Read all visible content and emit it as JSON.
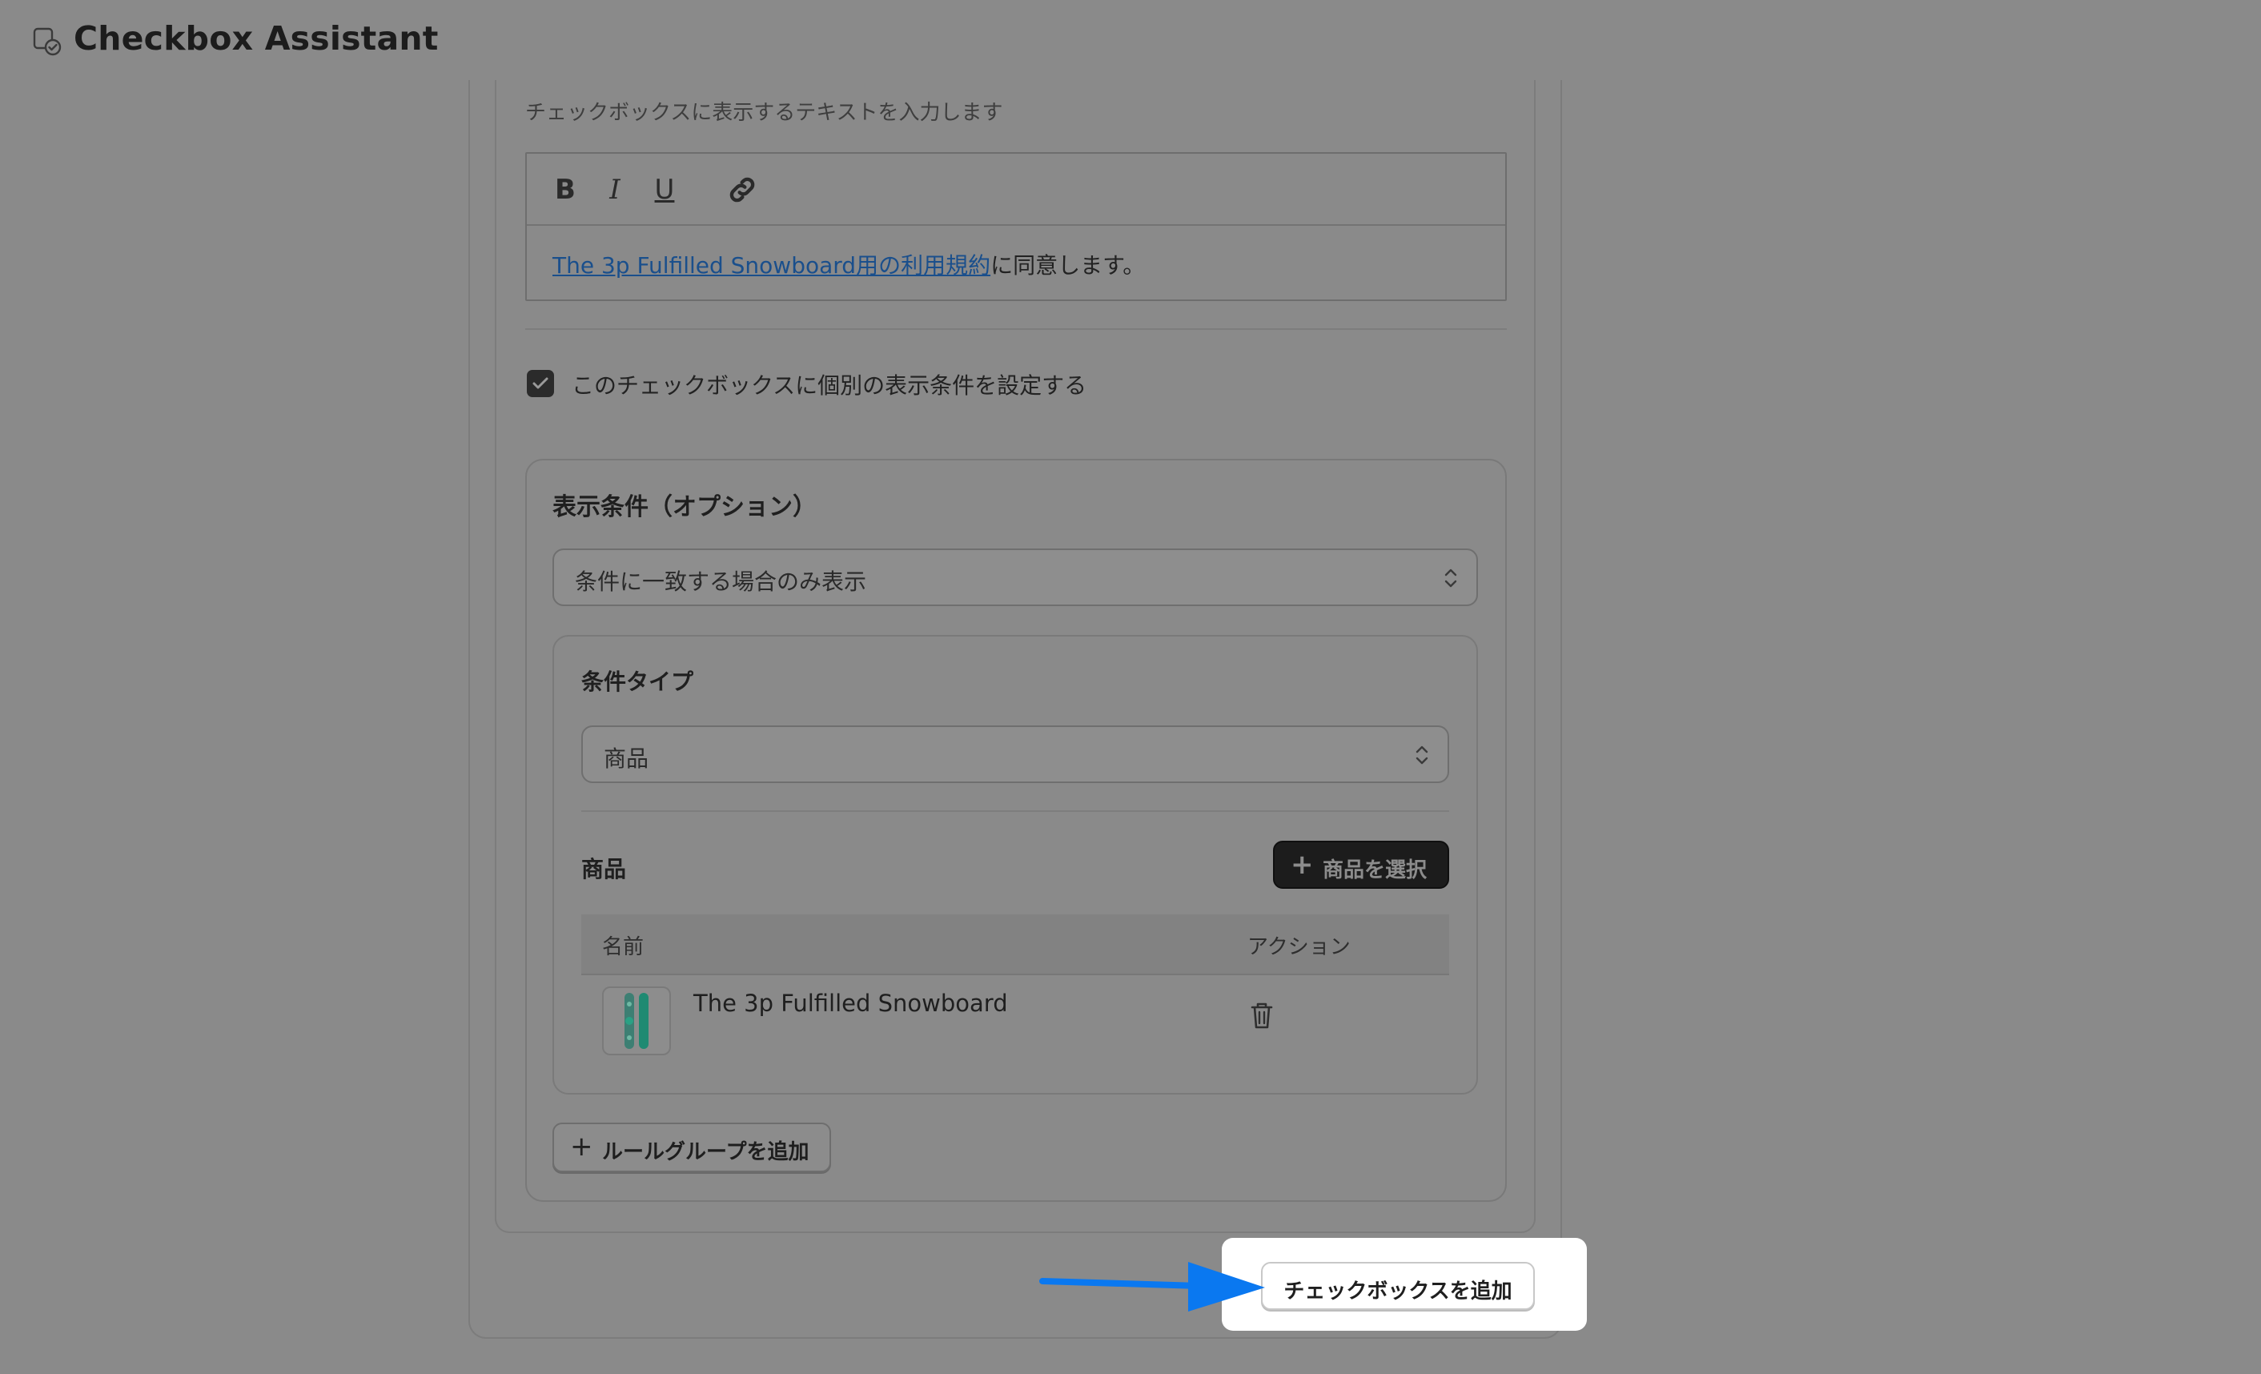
{
  "app": {
    "title": "Checkbox Assistant",
    "icon": "checkbox-assistant-logo-icon"
  },
  "editor": {
    "hint": "チェックボックスに表示するテキストを入力します",
    "toolbar": {
      "bold": "B",
      "italic": "I",
      "underline": "U",
      "link_icon": "link-icon"
    },
    "content_link": "The 3p Fulfilled Snowboard用の利用規約",
    "content_rest": "に同意します。"
  },
  "individual_conditions": {
    "checked": true,
    "label": "このチェックボックスに個別の表示条件を設定する"
  },
  "display_conditions": {
    "title": "表示条件（オプション）",
    "mode_selected": "条件に一致する場合のみ表示",
    "rule_group": {
      "condition_type_title": "条件タイプ",
      "condition_type_selected": "商品",
      "products_title": "商品",
      "select_products_label": "商品を選択",
      "table": {
        "columns": [
          "名前",
          "アクション"
        ],
        "rows": [
          {
            "name": "The 3p Fulfilled Snowboard",
            "action_icon": "trash-icon"
          }
        ]
      }
    },
    "add_rule_group_label": "ルールグループを追加"
  },
  "footer": {
    "add_checkbox_label": "チェックボックスを追加"
  },
  "colors": {
    "overlay": "#8a8a8a",
    "highlight": "#ffffff",
    "arrow": "#0a78f0",
    "link": "#1a4f8c"
  }
}
